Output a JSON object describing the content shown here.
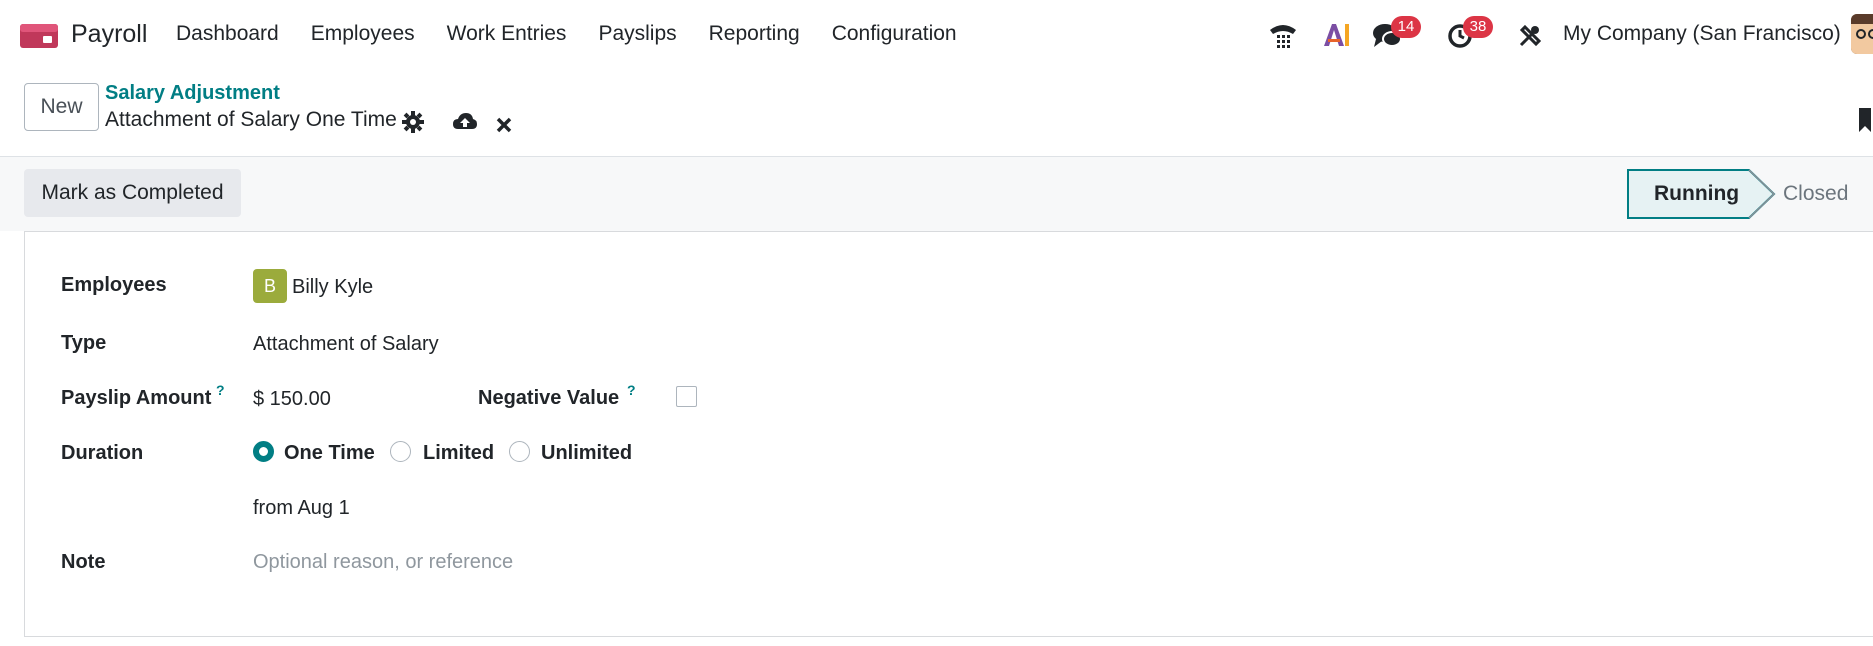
{
  "navbar": {
    "app_name": "Payroll",
    "menu": [
      "Dashboard",
      "Employees",
      "Work Entries",
      "Payslips",
      "Reporting",
      "Configuration"
    ],
    "systray": {
      "messages_count": "14",
      "activities_count": "38",
      "company": "My Company (San Francisco)"
    }
  },
  "control": {
    "new_label": "New",
    "breadcrumb": "Salary Adjustment",
    "record_title": "Attachment of Salary One Time"
  },
  "statusbar": {
    "complete_label": "Mark as Completed",
    "stages": [
      "Running",
      "Closed"
    ],
    "active_stage": "Running"
  },
  "form": {
    "employees_label": "Employees",
    "employee_initial": "B",
    "employee_name": "Billy Kyle",
    "type_label": "Type",
    "type_value": "Attachment of Salary",
    "amount_label": "Payslip Amount",
    "amount_value": "$ 150.00",
    "negative_label": "Negative Value",
    "help_mark": "?",
    "duration_label": "Duration",
    "duration_options": [
      "One Time",
      "Limited",
      "Unlimited"
    ],
    "duration_selected": "One Time",
    "from_text": "from Aug 1",
    "note_label": "Note",
    "note_placeholder": "Optional reason, or reference"
  },
  "colors": {
    "accent": "#017e84",
    "badge": "#dc3545",
    "avatar": "#9bab3c",
    "app_icon": "#c0385a"
  }
}
